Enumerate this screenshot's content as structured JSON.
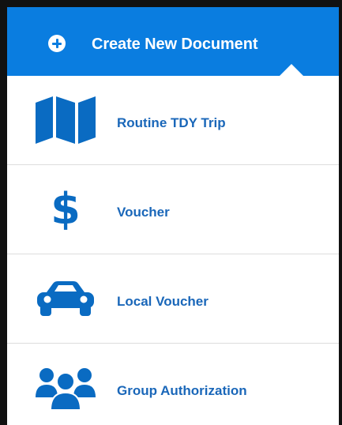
{
  "header": {
    "title": "Create New Document",
    "icon": "plus-circle-icon"
  },
  "menu": {
    "items": [
      {
        "label": "Routine TDY Trip",
        "icon": "map-icon"
      },
      {
        "label": "Voucher",
        "icon": "dollar-icon"
      },
      {
        "label": "Local Voucher",
        "icon": "car-icon"
      },
      {
        "label": "Group Authorization",
        "icon": "group-icon"
      }
    ]
  },
  "colors": {
    "accent": "#0a7de0",
    "icon": "#0a6bc2",
    "label": "#1a67b9"
  }
}
